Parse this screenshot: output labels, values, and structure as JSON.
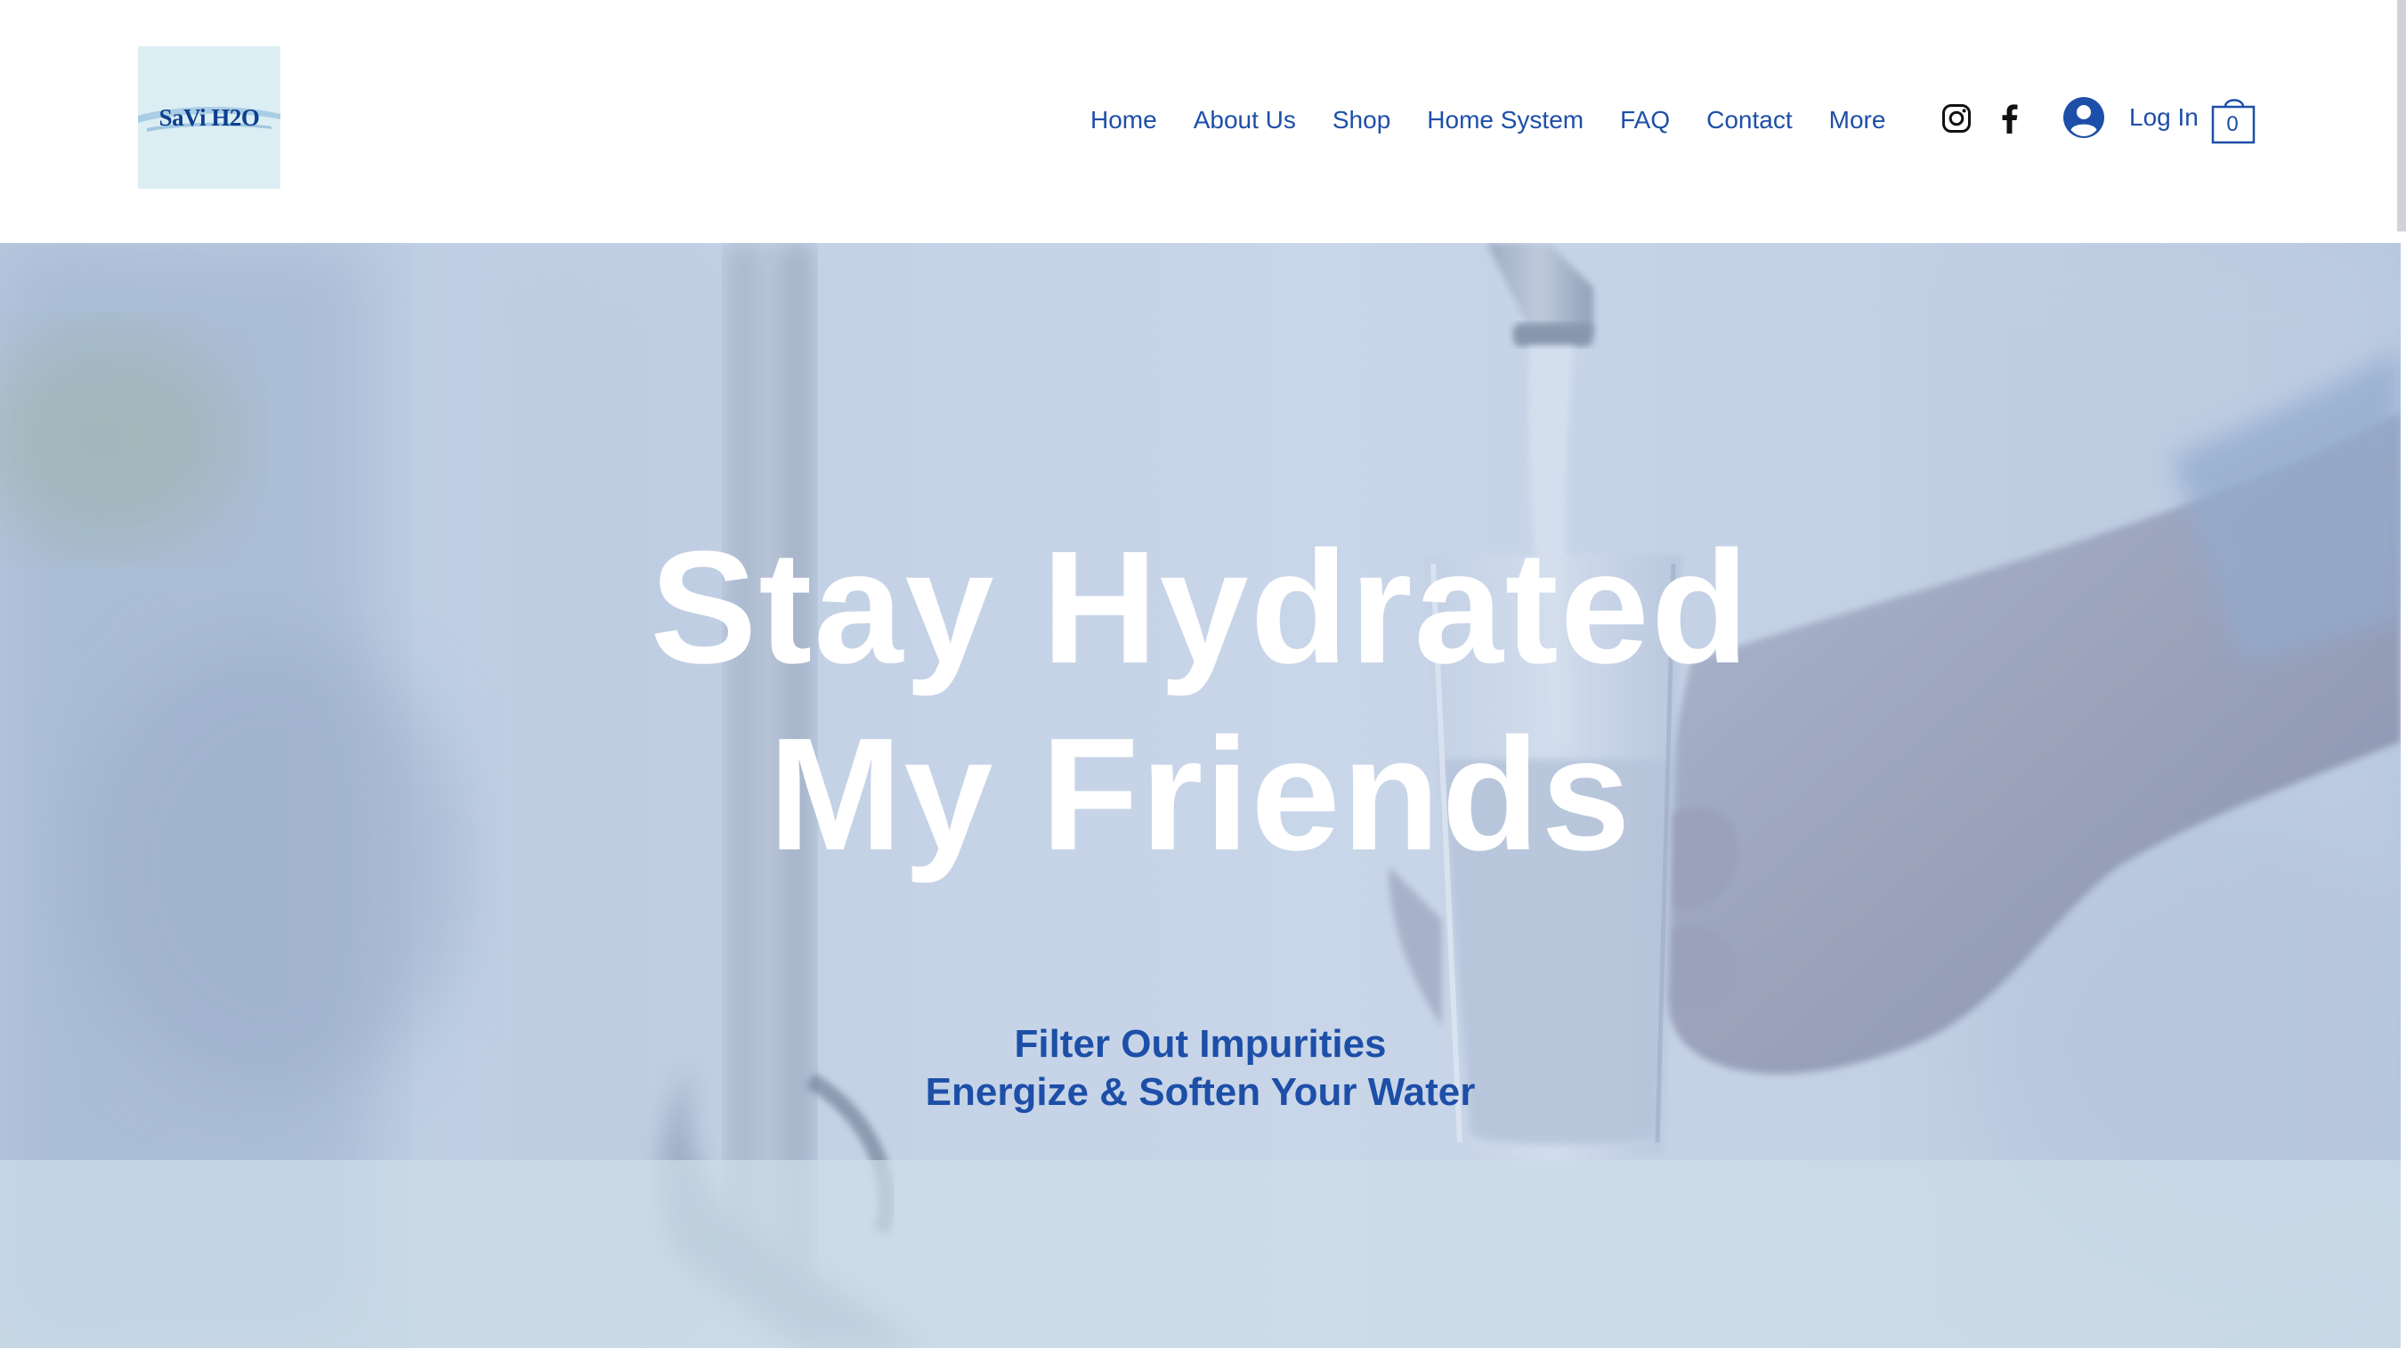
{
  "brand": {
    "logo_text": "SaVi H2O",
    "logo_bg": "#dbeef3",
    "primary_color": "#1d4fa8"
  },
  "nav": {
    "items": [
      "Home",
      "About Us",
      "Shop",
      "Home System",
      "FAQ",
      "Contact",
      "More"
    ]
  },
  "social": {
    "icons": [
      "instagram-icon",
      "facebook-icon"
    ]
  },
  "account": {
    "login_label": "Log In",
    "icon": "avatar-icon"
  },
  "cart": {
    "count": "0",
    "icon": "shopping-bag-icon"
  },
  "hero": {
    "title_line1": "Stay Hydrated",
    "title_line2": "My Friends"
  },
  "strip": {
    "line1": "Filter Out Impurities",
    "line2": "Energize & Soften Your Water"
  }
}
